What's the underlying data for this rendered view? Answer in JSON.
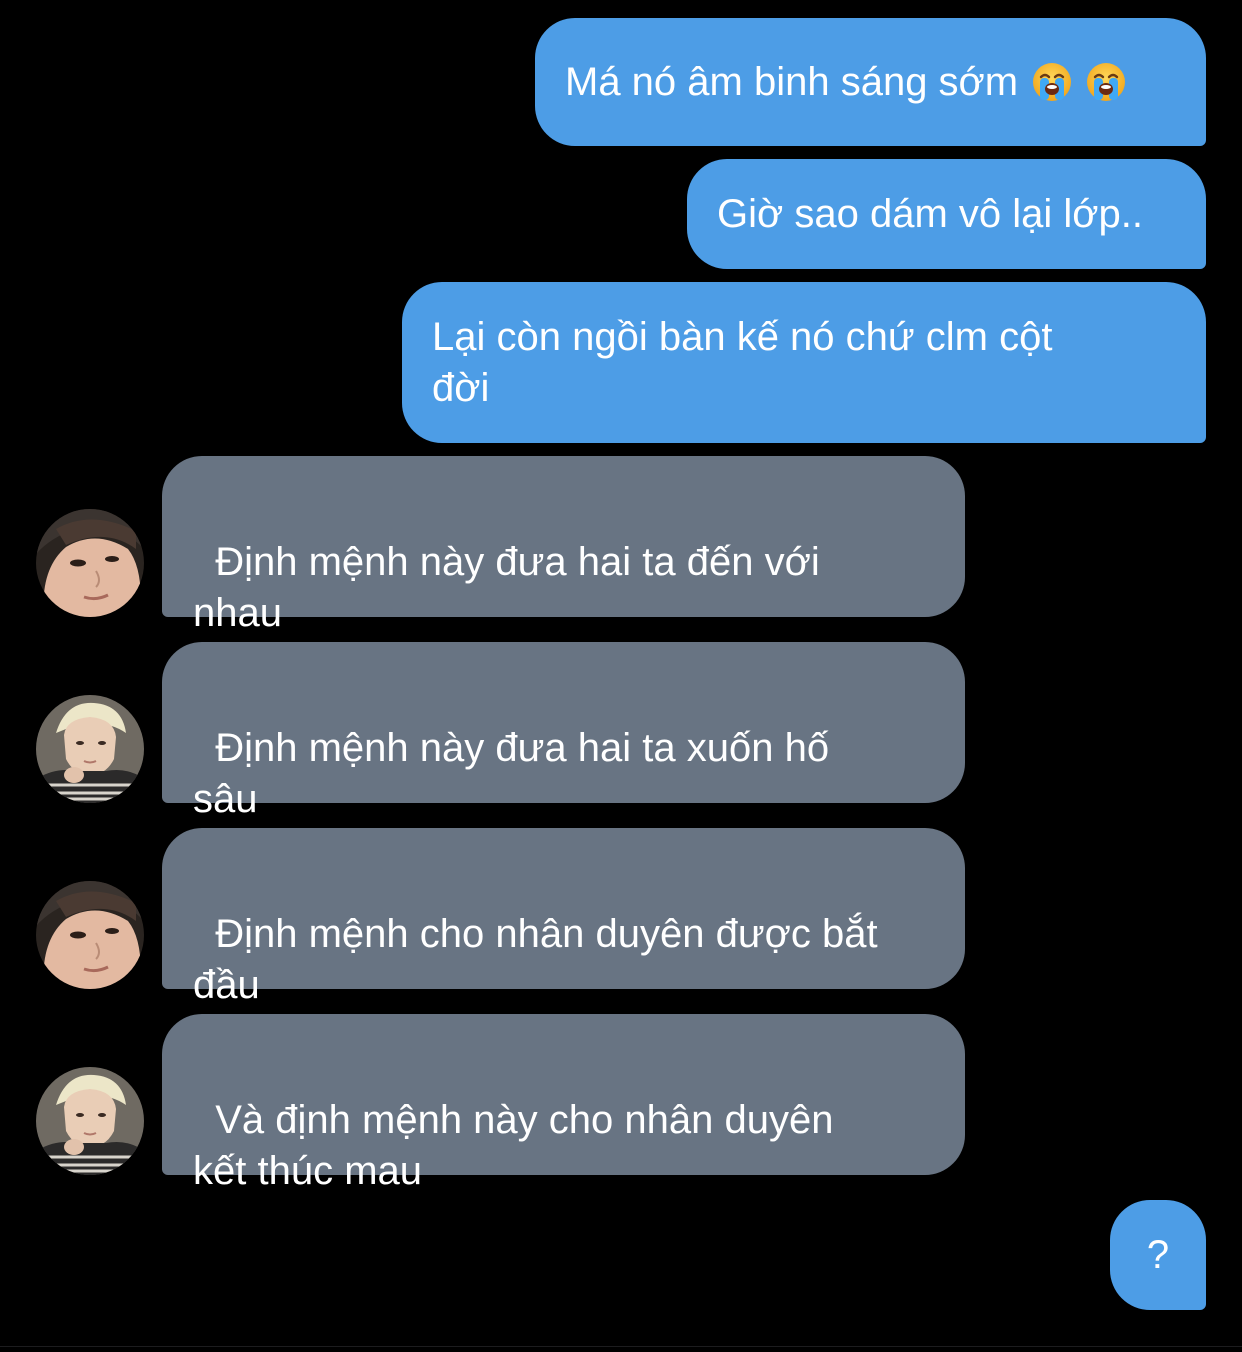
{
  "messages": {
    "outgoing": [
      {
        "text": "Má nó âm binh sáng sớm",
        "emoji": [
          "loudly-crying-face-icon",
          "loudly-crying-face-icon"
        ]
      },
      {
        "text": "Giờ sao dám vô lại lớp.."
      },
      {
        "text": "Lại còn ngồi bàn kế nó chứ clm cột\nđời"
      }
    ],
    "incoming": [
      {
        "text": "Định mệnh này đưa hai ta đến với\nnhau",
        "avatar": "avatar-a"
      },
      {
        "text": "Định mệnh này đưa hai ta xuốn hố\nsâu",
        "avatar": "avatar-b"
      },
      {
        "text": "Định mệnh cho nhân duyên được bắt\nđầu",
        "avatar": "avatar-a"
      },
      {
        "text": "Và định mệnh này cho nhân duyên\nkết thúc mau",
        "avatar": "avatar-b"
      }
    ],
    "final_outgoing": {
      "text": "?"
    }
  },
  "colors": {
    "background": "#000000",
    "outgoing_bubble": "#4d9de6",
    "incoming_bubble": "#687483",
    "text": "#ffffff"
  }
}
